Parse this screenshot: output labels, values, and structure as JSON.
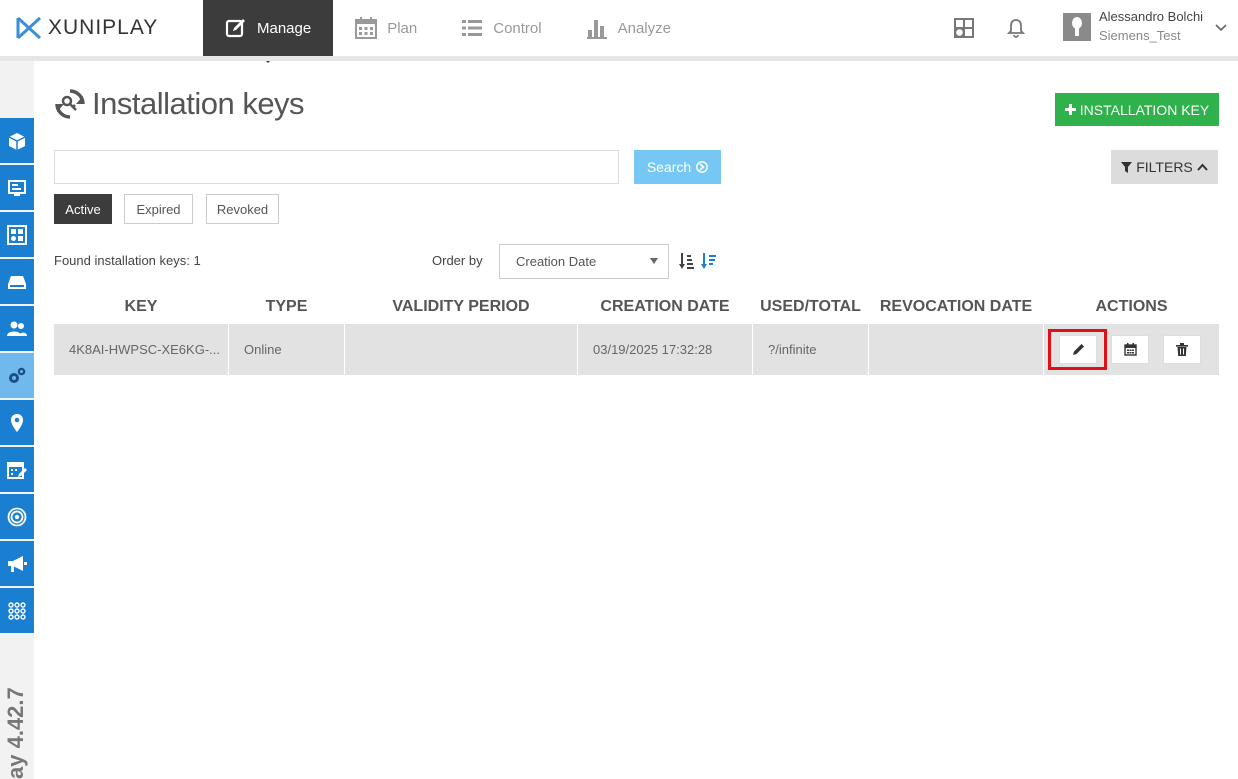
{
  "brand": {
    "name": "XUNIPLAY"
  },
  "nav": {
    "items": [
      {
        "label": "Manage",
        "icon": "edit-icon",
        "active": true
      },
      {
        "label": "Plan",
        "icon": "calendar-icon",
        "active": false
      },
      {
        "label": "Control",
        "icon": "list-icon",
        "active": false
      },
      {
        "label": "Analyze",
        "icon": "bar-chart-icon",
        "active": false
      }
    ]
  },
  "user": {
    "name": "Alessandro Bolchi",
    "org": "Siemens_Test"
  },
  "sidebar": {
    "icons": [
      "box-icon",
      "display-icon",
      "layout-icon",
      "drive-icon",
      "users-icon",
      "gears-icon",
      "location-icon",
      "calendar-edit-icon",
      "broadcast-icon",
      "megaphone-icon",
      "network-icon"
    ],
    "active_index": 5
  },
  "version": "ay 4.42.7",
  "page": {
    "title": "Installation keys",
    "add_button": "INSTALLATION KEY",
    "search_placeholder": "",
    "search_button": "Search",
    "filters_button": "FILTERS"
  },
  "status_tabs": [
    {
      "label": "Active",
      "active": true
    },
    {
      "label": "Expired",
      "active": false
    },
    {
      "label": "Revoked",
      "active": false
    }
  ],
  "results": {
    "found_text": "Found installation keys: 1",
    "order_label": "Order by",
    "order_value": "Creation Date"
  },
  "table": {
    "headers": [
      "KEY",
      "TYPE",
      "VALIDITY PERIOD",
      "CREATION DATE",
      "USED/TOTAL",
      "REVOCATION DATE",
      "ACTIONS"
    ],
    "rows": [
      {
        "key": "4K8AI-HWPSC-XE6KG-...",
        "type": "Online",
        "validity": "",
        "created": "03/19/2025 17:32:28",
        "used": "?/infinite",
        "revoked": ""
      }
    ]
  },
  "colors": {
    "primary_blue": "#1a7fd1",
    "sidebar_active": "#6fb9ec",
    "add_green": "#2fb14b",
    "search_blue": "#76c7f3",
    "highlight_red": "#e0101a"
  }
}
